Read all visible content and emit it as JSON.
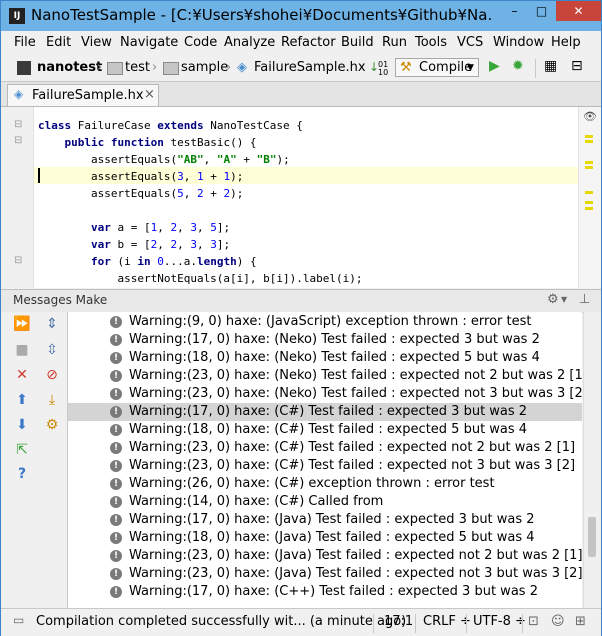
{
  "window": {
    "title": "NanoTestSample - [C:¥Users¥shohei¥Documents¥Github¥Na...",
    "app_icon": "IJ",
    "minimize": "–",
    "maximize": "□",
    "close": "✕"
  },
  "menu": [
    "File",
    "Edit",
    "View",
    "Navigate",
    "Code",
    "Analyze",
    "Refactor",
    "Build",
    "Run",
    "Tools",
    "VCS",
    "Window",
    "Help"
  ],
  "breadcrumbs": [
    "nanotest",
    "test",
    "sample",
    "FailureSample.hx"
  ],
  "toolbar": {
    "run_config": "Compile"
  },
  "editor_tab": {
    "label": "FailureSample.hx",
    "close": "×"
  },
  "code": [
    "class FailureCase extends NanoTestCase {",
    "    public function testBasic() {",
    "        assertEquals(\"AB\", \"A\" + \"B\");",
    "        assertEquals(3, 1 + 1);",
    "        assertEquals(5, 2 + 2);",
    "",
    "        var a = [1, 2, 3, 5];",
    "        var b = [2, 2, 3, 3];",
    "        for (i in 0...a.length) {",
    "            assertNotEquals(a[i], b[i]).label(i);"
  ],
  "panel": {
    "title": "Messages Make",
    "gear": "⚙",
    "hide": "⊥"
  },
  "messages": [
    "Warning:(9, 0)  haxe: (JavaScript) exception thrown : error test",
    "Warning:(17, 0)  haxe: (Neko) Test failed : expected 3 but was 2",
    "Warning:(18, 0)  haxe: (Neko) Test failed : expected 5 but was 4",
    "Warning:(23, 0)  haxe: (Neko) Test failed : expected not 2 but was 2 [1]",
    "Warning:(23, 0)  haxe: (Neko) Test failed : expected not 3 but was 3 [2]",
    "Warning:(17, 0)  haxe: (C#) Test failed : expected 3 but was 2",
    "Warning:(18, 0)  haxe: (C#) Test failed : expected 5 but was 4",
    "Warning:(23, 0)  haxe: (C#) Test failed : expected not 2 but was 2 [1]",
    "Warning:(23, 0)  haxe: (C#) Test failed : expected not 3 but was 3 [2]",
    "Warning:(26, 0)  haxe: (C#) exception thrown : error test",
    "Warning:(14, 0)  haxe: (C#) Called from",
    "Warning:(17, 0)  haxe: (Java) Test failed : expected 3 but was 2",
    "Warning:(18, 0)  haxe: (Java) Test failed : expected 5 but was 4",
    "Warning:(23, 0)  haxe: (Java) Test failed : expected not 2 but was 2 [1]",
    "Warning:(23, 0)  haxe: (Java) Test failed : expected not 3 but was 3 [2]",
    "Warning:(17, 0)  haxe: (C++) Test failed : expected 3 but was 2"
  ],
  "selected_message_index": 5,
  "status": {
    "message": "Compilation completed successfully wit... (a minute ago)",
    "position": "17:1",
    "line_sep": "CRLF ÷",
    "encoding": "UTF-8 ÷"
  },
  "colors": {
    "title_bar": "#6fb3e6",
    "close_button": "#c7453a",
    "keyword": "#000080",
    "string": "#008000",
    "number": "#0000ff",
    "highlight_line": "#ffffd7",
    "selection": "#d4d4d4"
  }
}
